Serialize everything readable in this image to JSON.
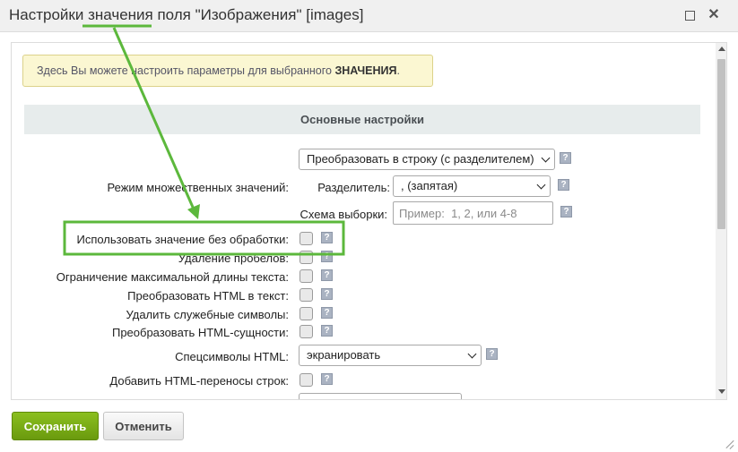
{
  "dialog": {
    "title": "Настройки значения поля \"Изображения\" [images]",
    "maximize_icon": "maximize-icon",
    "close_symbol": "✕"
  },
  "info": {
    "text": "Здесь Вы можете настроить параметры для выбранного ",
    "bold": "ЗНАЧЕНИЯ",
    "end": "."
  },
  "section": {
    "title": "Основные настройки"
  },
  "multiple": {
    "label": "Режим множественных значений:",
    "mode_value": "Преобразовать в строку (с разделителем)",
    "separator_label": "Разделитель:",
    "separator_value": ", (запятая)",
    "schema_label": "Схема выборки:",
    "schema_placeholder": "Пример:  1, 2, или 4-8"
  },
  "options": {
    "raw": "Использовать значение без обработки:",
    "trim": "Удаление пробелов:",
    "maxlen": "Ограничение максимальной длины текста:",
    "html2text": "Преобразовать HTML в текст:",
    "strip": "Удалить служебные символы:",
    "entities": "Преобразовать HTML-сущности:",
    "specialchars_label": "Спецсимволы HTML:",
    "specialchars_value": "экранировать",
    "nl2br": "Добавить HTML-переносы строк:"
  },
  "help_symbol": "?",
  "footer": {
    "save": "Сохранить",
    "cancel": "Отменить"
  },
  "colors": {
    "annotation": "#5cb83c",
    "save_button": "#7aad17",
    "info_background": "#fbf7d2"
  }
}
